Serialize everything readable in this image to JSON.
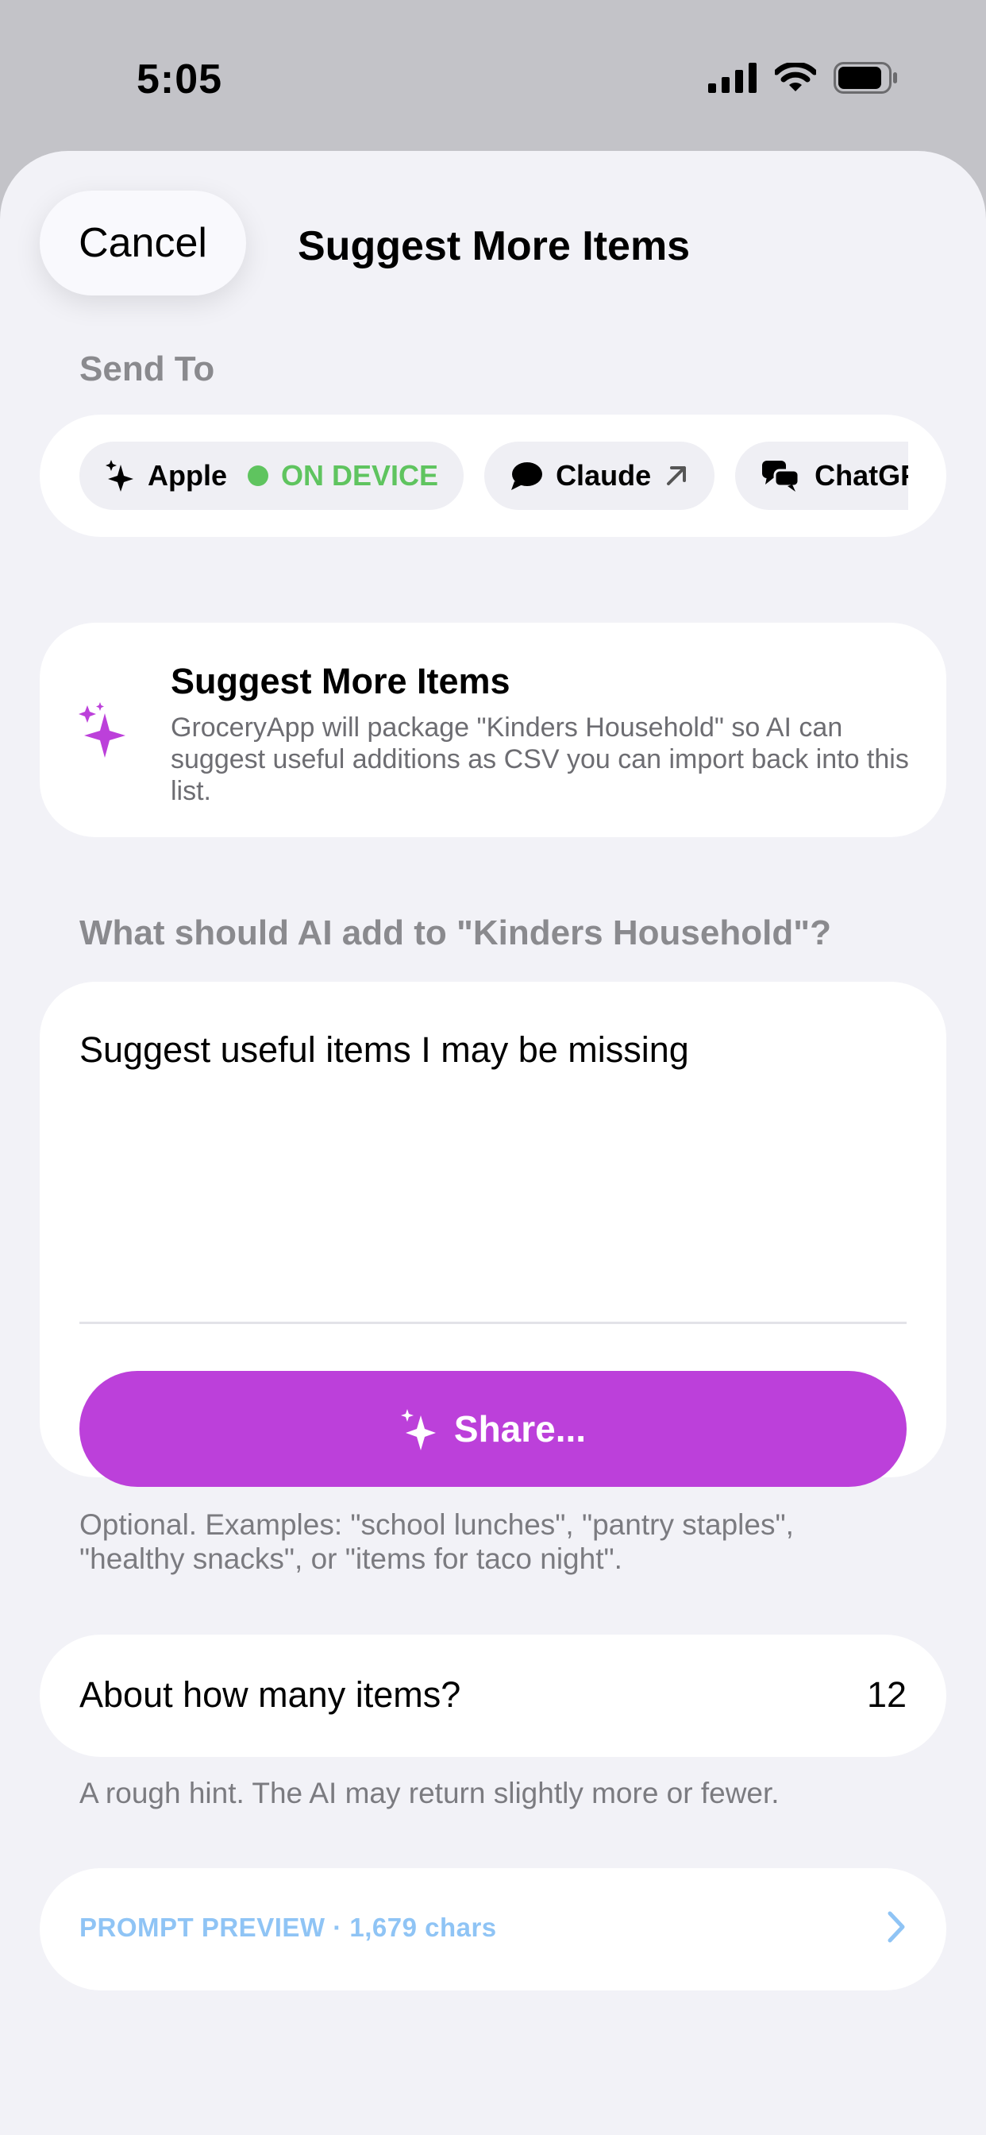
{
  "status_bar": {
    "time": "5:05"
  },
  "header": {
    "cancel_label": "Cancel",
    "title": "Suggest More Items"
  },
  "send_to": {
    "label": "Send To",
    "providers": [
      {
        "name": "Apple",
        "badge": "ON DEVICE",
        "icon": "sparkles-icon"
      },
      {
        "name": "Claude",
        "icon": "chat-bubble-icon",
        "trailing_icon": "arrow-up-right-icon"
      },
      {
        "name": "ChatGPT",
        "icon": "chat-bubbles-icon"
      }
    ]
  },
  "info": {
    "title": "Suggest More Items",
    "description": "GroceryApp will package \"Kinders Household\" so AI can suggest useful additions as CSV you can import back into this list.",
    "icon": "sparkles-icon"
  },
  "prompt": {
    "label": "What should AI add to \"Kinders Household\"?",
    "text": "Suggest useful items I may be missing",
    "share_label": "Share...",
    "hint": "Optional. Examples: \"school lunches\", \"pantry staples\", \"healthy snacks\", or \"items for taco night\"."
  },
  "count": {
    "label": "About how many items?",
    "value": "12",
    "hint": "A rough hint. The AI may return slightly more or fewer."
  },
  "preview": {
    "label": "PROMPT PREVIEW · 1,679 chars"
  },
  "colors": {
    "accent": "#bc40da",
    "on_device": "#5fc45f",
    "link": "#8fc4f5",
    "background": "#f2f2f7"
  }
}
